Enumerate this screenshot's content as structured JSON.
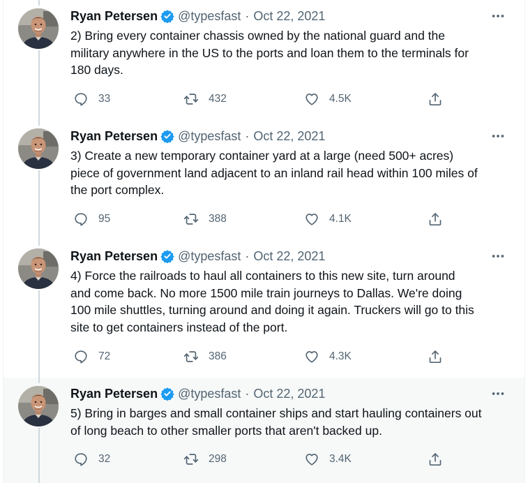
{
  "author": {
    "name": "Ryan Petersen",
    "handle": "@typesfast",
    "separator": "·",
    "verified_icon": "verified-badge-icon",
    "brand_color": "#1d9bf0"
  },
  "tweets": [
    {
      "date": "Oct 22, 2021",
      "text": "2) Bring every container chassis  owned by the national guard and the\nmilitary anywhere in the US to the ports and loan them to the terminals for\n180 days.",
      "replies": "33",
      "retweets": "432",
      "likes": "4.5K"
    },
    {
      "date": "Oct 22, 2021",
      "text": "3) Create a new temporary container yard at a large (need 500+ acres)\npiece of government land adjacent to an inland rail head within 100 miles of\nthe port complex.",
      "replies": "95",
      "retweets": "388",
      "likes": "4.1K"
    },
    {
      "date": "Oct 22, 2021",
      "text": "4) Force the railroads to haul all containers to this new site, turn around\nand come back. No more 1500 mile train journeys to Dallas. We're doing\n100 mile shuttles, turning around and doing it again. Truckers will go to this\nsite to get containers instead of the port.",
      "replies": "72",
      "retweets": "386",
      "likes": "4.3K"
    },
    {
      "date": "Oct 22, 2021",
      "text": "5) Bring in barges and small container ships and start hauling containers out\nof long beach to other smaller ports that aren't backed up.",
      "replies": "32",
      "retweets": "298",
      "likes": "3.4K"
    }
  ],
  "icons": {
    "reply": "reply-icon",
    "retweet": "retweet-icon",
    "like": "heart-icon",
    "share": "share-icon",
    "more": "more-options-icon"
  }
}
